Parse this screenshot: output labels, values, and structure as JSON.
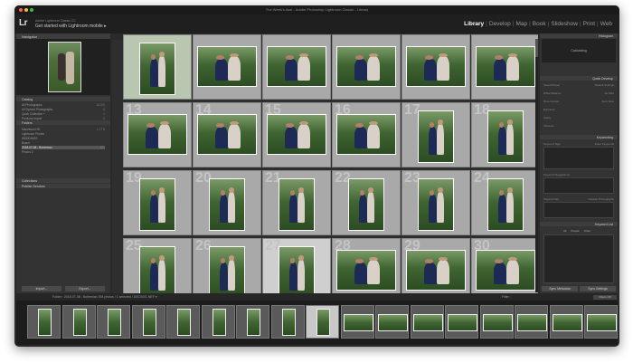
{
  "window": {
    "title": "The Week's Asst - Adobe Photoshop Lightroom Classic - Library"
  },
  "identity": {
    "logo": "Lr",
    "catalog_line": "Adobe Lightroom Classic CC",
    "catalog_title": "Get started with Lightroom mobile ▸"
  },
  "modules": [
    {
      "label": "Library",
      "active": true
    },
    {
      "label": "Develop",
      "active": false
    },
    {
      "label": "Map",
      "active": false
    },
    {
      "label": "Book",
      "active": false
    },
    {
      "label": "Slideshow",
      "active": false
    },
    {
      "label": "Print",
      "active": false
    },
    {
      "label": "Web",
      "active": false
    }
  ],
  "left_panel": {
    "navigator_label": "Navigator",
    "catalog_label": "Catalog",
    "catalog_items": [
      {
        "label": "All Photographs",
        "count": "16,000"
      },
      {
        "label": "All Synced Photographs",
        "count": "6"
      },
      {
        "label": "Quick Collection +",
        "count": "0"
      },
      {
        "label": "Previous Import",
        "count": "8"
      }
    ],
    "folders_label": "Folders",
    "folder_items": [
      {
        "label": "Macintosh HD",
        "count": "1.2 TB"
      },
      {
        "label": "Lightroom Photos",
        "count": ""
      },
      {
        "label": "WEDDINGS",
        "count": ""
      },
      {
        "label": "Board",
        "count": ""
      },
      {
        "label": "2018-07-08 - Bohemian",
        "count": "480"
      },
      {
        "label": "Photos 2",
        "count": ""
      }
    ],
    "collections_label": "Collections",
    "publish_label": "Publish Services",
    "import_button": "Import...",
    "export_button": "Export..."
  },
  "grid": {
    "toolbar_label": "Library Filter :",
    "filters": [
      {
        "label": "Text",
        "on": false
      },
      {
        "label": "Attribute",
        "on": false
      },
      {
        "label": "Metadata",
        "on": false
      },
      {
        "label": "None",
        "on": true
      }
    ],
    "rows": [
      [
        {
          "num": "",
          "orient": "p",
          "sel": true
        },
        {
          "num": "",
          "orient": "l",
          "sel": false
        },
        {
          "num": "",
          "orient": "l",
          "sel": false
        },
        {
          "num": "",
          "orient": "l",
          "sel": false
        },
        {
          "num": "",
          "orient": "l",
          "sel": false
        },
        {
          "num": "",
          "orient": "l",
          "sel": false
        }
      ],
      [
        {
          "num": "13",
          "orient": "l",
          "sel": false
        },
        {
          "num": "14",
          "orient": "l",
          "sel": false
        },
        {
          "num": "15",
          "orient": "l",
          "sel": false
        },
        {
          "num": "16",
          "orient": "l",
          "sel": false
        },
        {
          "num": "17",
          "orient": "p",
          "sel": false
        },
        {
          "num": "18",
          "orient": "p",
          "sel": false
        }
      ],
      [
        {
          "num": "19",
          "orient": "p",
          "sel": false
        },
        {
          "num": "20",
          "orient": "p",
          "sel": false
        },
        {
          "num": "21",
          "orient": "p",
          "sel": false
        },
        {
          "num": "22",
          "orient": "p",
          "sel": false
        },
        {
          "num": "23",
          "orient": "p",
          "sel": false
        },
        {
          "num": "24",
          "orient": "p",
          "sel": false
        }
      ],
      [
        {
          "num": "25",
          "orient": "p",
          "sel": false
        },
        {
          "num": "26",
          "orient": "p",
          "sel": false
        },
        {
          "num": "27",
          "orient": "p",
          "sel": true
        },
        {
          "num": "28",
          "orient": "l",
          "sel": false
        },
        {
          "num": "29",
          "orient": "l",
          "sel": false
        },
        {
          "num": "30",
          "orient": "l",
          "sel": false
        }
      ]
    ]
  },
  "right_panel": {
    "histogram_label": "Histogram",
    "histogram_status": "Calculating",
    "quick_develop_label": "Quick Develop",
    "quick_develop_rows": [
      {
        "label": "Saved Preset",
        "value": "Default Settings"
      },
      {
        "label": "White Balance",
        "value": "As Shot"
      },
      {
        "label": "Tone Control",
        "value": "Auto Tone"
      },
      {
        "label": "Exposure",
        "value": ""
      },
      {
        "label": "Clarity",
        "value": ""
      },
      {
        "label": "Vibrance",
        "value": ""
      }
    ],
    "keywording_label": "Keywording",
    "keyword_tags_label": "Keyword Tags",
    "keyword_tags_value": "Enter Keywords",
    "keyword_suggestions_label": "Keyword Suggestions",
    "keyword_set_label": "Keyword Set",
    "keyword_set_value": "Outdoor Photography",
    "keyword_list_label": "Keyword List",
    "keyword_list_filter": [
      "All",
      "People",
      "Other"
    ],
    "sync_metadata_button": "Sync Metadata",
    "sync_settings_button": "Sync Settings"
  },
  "toolbar": {
    "path": "Folder : 2018-07-08 - Bohemian   394 photos / 1 selected / DSC0001.NEF ▾",
    "filter_label": "Filter :",
    "filter_value": "Filters Off"
  },
  "filmstrip": {
    "cells": [
      {
        "orient": "p",
        "sel": false
      },
      {
        "orient": "p",
        "sel": false
      },
      {
        "orient": "p",
        "sel": false
      },
      {
        "orient": "p",
        "sel": false
      },
      {
        "orient": "p",
        "sel": false
      },
      {
        "orient": "p",
        "sel": false
      },
      {
        "orient": "p",
        "sel": false
      },
      {
        "orient": "p",
        "sel": false
      },
      {
        "orient": "p",
        "sel": true
      },
      {
        "orient": "l",
        "sel": false
      },
      {
        "orient": "l",
        "sel": false
      },
      {
        "orient": "l",
        "sel": false
      },
      {
        "orient": "l",
        "sel": false
      },
      {
        "orient": "l",
        "sel": false
      },
      {
        "orient": "l",
        "sel": false
      },
      {
        "orient": "l",
        "sel": false
      },
      {
        "orient": "l",
        "sel": false
      }
    ]
  }
}
